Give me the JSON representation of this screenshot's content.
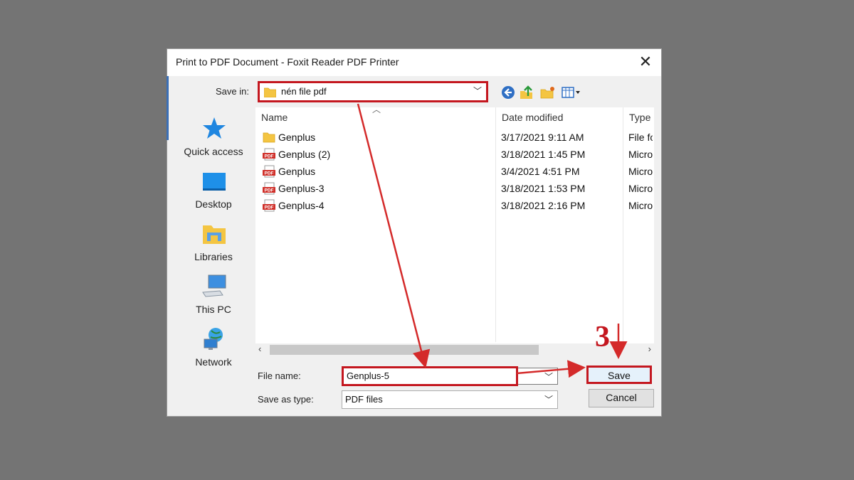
{
  "window": {
    "title": "Print to PDF Document - Foxit Reader PDF Printer",
    "close_glyph": "✕"
  },
  "save_in": {
    "label": "Save in:",
    "location": "nén file pdf"
  },
  "toolbar_icons": [
    "back-icon",
    "up-folder-icon",
    "new-folder-icon",
    "view-menu-icon"
  ],
  "places": [
    {
      "label": "Quick access",
      "icon": "star-icon"
    },
    {
      "label": "Desktop",
      "icon": "desktop-icon"
    },
    {
      "label": "Libraries",
      "icon": "libraries-icon"
    },
    {
      "label": "This PC",
      "icon": "computer-icon"
    },
    {
      "label": "Network",
      "icon": "network-icon"
    }
  ],
  "columns": {
    "name": "Name",
    "date": "Date modified",
    "type": "Type"
  },
  "files": [
    {
      "name": "Genplus",
      "date": "3/17/2021 9:11 AM",
      "type": "File fo",
      "kind": "folder"
    },
    {
      "name": "Genplus (2)",
      "date": "3/18/2021 1:45 PM",
      "type": "Micro",
      "kind": "pdf"
    },
    {
      "name": "Genplus",
      "date": "3/4/2021 4:51 PM",
      "type": "Micro",
      "kind": "pdf"
    },
    {
      "name": "Genplus-3",
      "date": "3/18/2021 1:53 PM",
      "type": "Micro",
      "kind": "pdf"
    },
    {
      "name": "Genplus-4",
      "date": "3/18/2021 2:16 PM",
      "type": "Micro",
      "kind": "pdf"
    }
  ],
  "pdf_badge": "PDF",
  "file_name": {
    "label": "File name:",
    "value": "Genplus-5"
  },
  "save_as_type": {
    "label": "Save as type:",
    "value": "PDF files"
  },
  "buttons": {
    "save": "Save",
    "cancel": "Cancel"
  },
  "annotation": {
    "step": "3"
  },
  "colors": {
    "highlight": "#c4171f",
    "folder": "#f4c542",
    "pdf": "#d0302a",
    "accent": "#3b6fb6"
  }
}
